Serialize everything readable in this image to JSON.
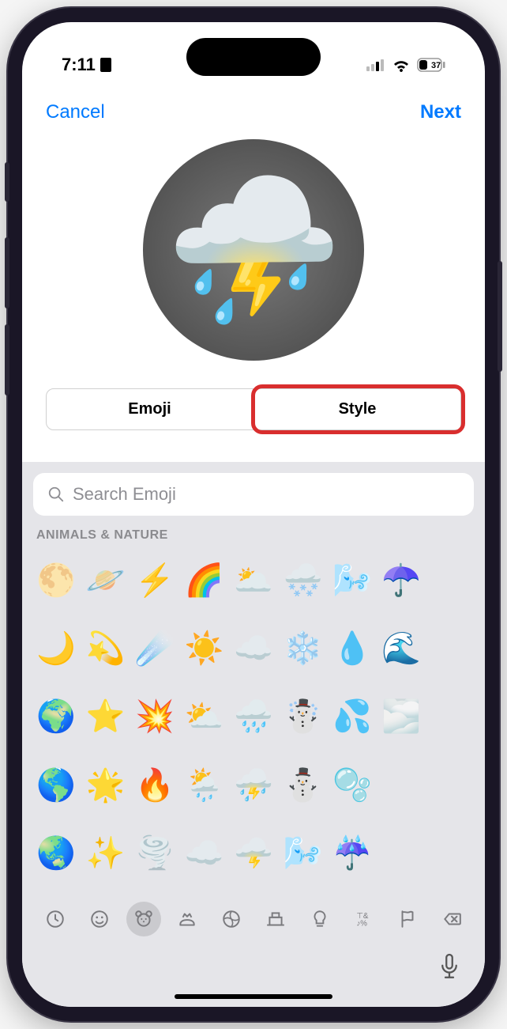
{
  "status": {
    "time": "7:11",
    "battery": "37"
  },
  "nav": {
    "cancel": "Cancel",
    "next": "Next"
  },
  "preview": {
    "emoji": "⛈️"
  },
  "segments": {
    "emoji": "Emoji",
    "style": "Style",
    "active": "emoji"
  },
  "search": {
    "placeholder": "Search Emoji"
  },
  "category": {
    "label": "ANIMALS & NATURE"
  },
  "emoji_grid": [
    [
      "🌕",
      "🪐",
      "⚡",
      "🌈",
      "🌥️",
      "🌨️",
      "🌬️",
      "☂️",
      ""
    ],
    [
      "🌙",
      "💫",
      "☄️",
      "☀️",
      "☁️",
      "❄️",
      "💧",
      "🌊",
      ""
    ],
    [
      "🌍",
      "⭐",
      "💥",
      "⛅",
      "🌧️",
      "☃️",
      "💦",
      "🌫️",
      ""
    ],
    [
      "🌎",
      "🌟",
      "🔥",
      "🌦️",
      "⛈️",
      "⛄",
      "🫧",
      "",
      ""
    ],
    [
      "🌏",
      "✨",
      "🌪️",
      "☁️",
      "🌩️",
      "🌬️",
      "☔",
      "",
      ""
    ]
  ],
  "cat_icons": [
    "recent",
    "smileys",
    "animals",
    "food",
    "activity",
    "travel",
    "objects",
    "symbols",
    "flags",
    "delete"
  ]
}
